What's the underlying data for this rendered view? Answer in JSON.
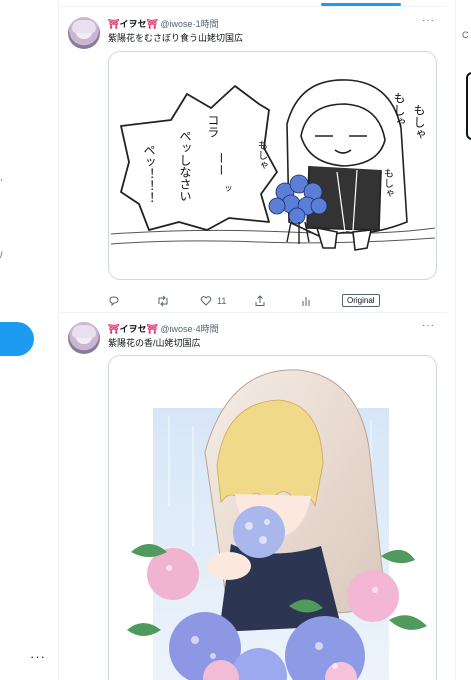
{
  "sidebar": {
    "more_label": "···"
  },
  "tweets": [
    {
      "torii_left": "⛩",
      "display_name": "イヲセ",
      "torii_right": "⛩",
      "handle": "@iwose",
      "separator": "·",
      "time": "1時間",
      "text": "紫陽花をむさぼり食う山姥切国広",
      "menu": "···",
      "media": {
        "speech": [
          "コラ",
          "ーー",
          "ッ",
          "ぺッしなさい",
          "ペッ！！！"
        ],
        "sfx": [
          "もしゃ",
          "もしゃ",
          "もしゃ",
          "もしゃ"
        ]
      },
      "actions": {
        "like_count": "11",
        "original_label": "Original"
      }
    },
    {
      "torii_left": "⛩",
      "display_name": "イヲセ",
      "torii_right": "⛩",
      "handle": "@iwose",
      "separator": "·",
      "time": "4時間",
      "text": "紫陽花の香/山姥切国広",
      "menu": "···"
    }
  ],
  "colors": {
    "accent": "#1d9bf0",
    "text": "#0f1419",
    "muted": "#536471",
    "hydrangea": "#5b7fd6"
  }
}
